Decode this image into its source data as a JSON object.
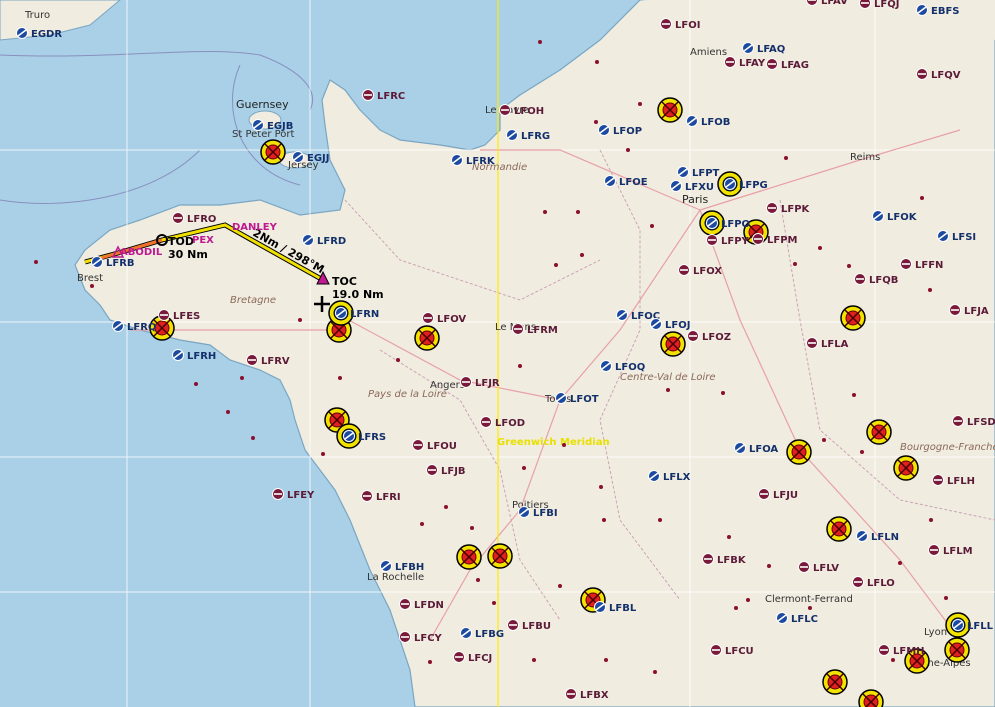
{
  "map": {
    "regions": [
      "Normandie",
      "Bretagne",
      "Pays de la Loire",
      "Centre-Val de Loire",
      "Bourgogne-Franche-Comté"
    ],
    "places": [
      "Truro",
      "Guernsey",
      "St Peter Port",
      "Jersey",
      "Brest",
      "Amiens",
      "Le Havre",
      "Reims",
      "Paris",
      "Angers",
      "Le Mans",
      "Tours",
      "Poitiers",
      "La Rochelle",
      "Clermont-Ferrand",
      "Lyon",
      "Rhône-Alpes"
    ],
    "meridian_label": "Greenwich Meridian",
    "route": {
      "color": "#f0e000",
      "tod_label": "TOD",
      "tod_dist": "30 Nm",
      "toc_label": "TOC",
      "toc_dist": "19.0 Nm",
      "leg_label": "2Nm / 298°M",
      "waypoints": [
        "ABODIL",
        "PEX",
        "DANLEY"
      ]
    },
    "airports": [
      {
        "code": "EGDR",
        "kind": "blue"
      },
      {
        "code": "EGJB",
        "kind": "blue"
      },
      {
        "code": "EGJJ",
        "kind": "blue"
      },
      {
        "code": "LFRC",
        "kind": "red"
      },
      {
        "code": "LFOH",
        "kind": "red"
      },
      {
        "code": "LFRG",
        "kind": "blue"
      },
      {
        "code": "LFRK",
        "kind": "blue"
      },
      {
        "code": "LFOI",
        "kind": "red"
      },
      {
        "code": "LFAQ",
        "kind": "blue"
      },
      {
        "code": "LFAY",
        "kind": "red"
      },
      {
        "code": "LFAG",
        "kind": "red"
      },
      {
        "code": "LFAV",
        "kind": "red"
      },
      {
        "code": "LFQJ",
        "kind": "red"
      },
      {
        "code": "EBFS",
        "kind": "blue"
      },
      {
        "code": "LFQV",
        "kind": "red"
      },
      {
        "code": "LFOP",
        "kind": "blue"
      },
      {
        "code": "LFOB",
        "kind": "blue"
      },
      {
        "code": "LFOE",
        "kind": "blue"
      },
      {
        "code": "LFPT",
        "kind": "blue"
      },
      {
        "code": "LFPG",
        "kind": "blue"
      },
      {
        "code": "LFXU",
        "kind": "blue"
      },
      {
        "code": "LFPO",
        "kind": "blue"
      },
      {
        "code": "LFPY",
        "kind": "red"
      },
      {
        "code": "LFPM",
        "kind": "red"
      },
      {
        "code": "LFPK",
        "kind": "red"
      },
      {
        "code": "LFOK",
        "kind": "blue"
      },
      {
        "code": "LFSI",
        "kind": "blue"
      },
      {
        "code": "LFFN",
        "kind": "red"
      },
      {
        "code": "LFQB",
        "kind": "red"
      },
      {
        "code": "LFOX",
        "kind": "red"
      },
      {
        "code": "LFRO",
        "kind": "red"
      },
      {
        "code": "LFRD",
        "kind": "blue"
      },
      {
        "code": "LFRB",
        "kind": "blue"
      },
      {
        "code": "LFRQ",
        "kind": "blue"
      },
      {
        "code": "LFES",
        "kind": "red"
      },
      {
        "code": "LFRH",
        "kind": "blue"
      },
      {
        "code": "LFRV",
        "kind": "red"
      },
      {
        "code": "LFRN",
        "kind": "blue"
      },
      {
        "code": "LFOV",
        "kind": "red"
      },
      {
        "code": "LFRM",
        "kind": "red"
      },
      {
        "code": "LFOC",
        "kind": "blue"
      },
      {
        "code": "LFOJ",
        "kind": "blue"
      },
      {
        "code": "LFOZ",
        "kind": "red"
      },
      {
        "code": "LFOQ",
        "kind": "blue"
      },
      {
        "code": "LFLA",
        "kind": "red"
      },
      {
        "code": "LFJA",
        "kind": "red"
      },
      {
        "code": "LFJR",
        "kind": "red"
      },
      {
        "code": "LFOT",
        "kind": "blue"
      },
      {
        "code": "LFRS",
        "kind": "blue"
      },
      {
        "code": "LFOD",
        "kind": "red"
      },
      {
        "code": "LFOU",
        "kind": "red"
      },
      {
        "code": "LFJB",
        "kind": "red"
      },
      {
        "code": "LFOA",
        "kind": "blue"
      },
      {
        "code": "LFSD",
        "kind": "red"
      },
      {
        "code": "LFLX",
        "kind": "blue"
      },
      {
        "code": "LFLH",
        "kind": "red"
      },
      {
        "code": "LFEY",
        "kind": "red"
      },
      {
        "code": "LFRI",
        "kind": "red"
      },
      {
        "code": "LFBI",
        "kind": "blue"
      },
      {
        "code": "LFJU",
        "kind": "red"
      },
      {
        "code": "LFLN",
        "kind": "blue"
      },
      {
        "code": "LFLM",
        "kind": "red"
      },
      {
        "code": "LFBH",
        "kind": "blue"
      },
      {
        "code": "LFBK",
        "kind": "red"
      },
      {
        "code": "LFLV",
        "kind": "red"
      },
      {
        "code": "LFLO",
        "kind": "red"
      },
      {
        "code": "LFDN",
        "kind": "red"
      },
      {
        "code": "LFBL",
        "kind": "blue"
      },
      {
        "code": "LFCY",
        "kind": "red"
      },
      {
        "code": "LFBG",
        "kind": "blue"
      },
      {
        "code": "LFBU",
        "kind": "red"
      },
      {
        "code": "LFLC",
        "kind": "blue"
      },
      {
        "code": "LFLL",
        "kind": "blue"
      },
      {
        "code": "LFCJ",
        "kind": "red"
      },
      {
        "code": "LFCU",
        "kind": "red"
      },
      {
        "code": "LFMH",
        "kind": "red"
      },
      {
        "code": "LFBX",
        "kind": "red"
      }
    ]
  }
}
